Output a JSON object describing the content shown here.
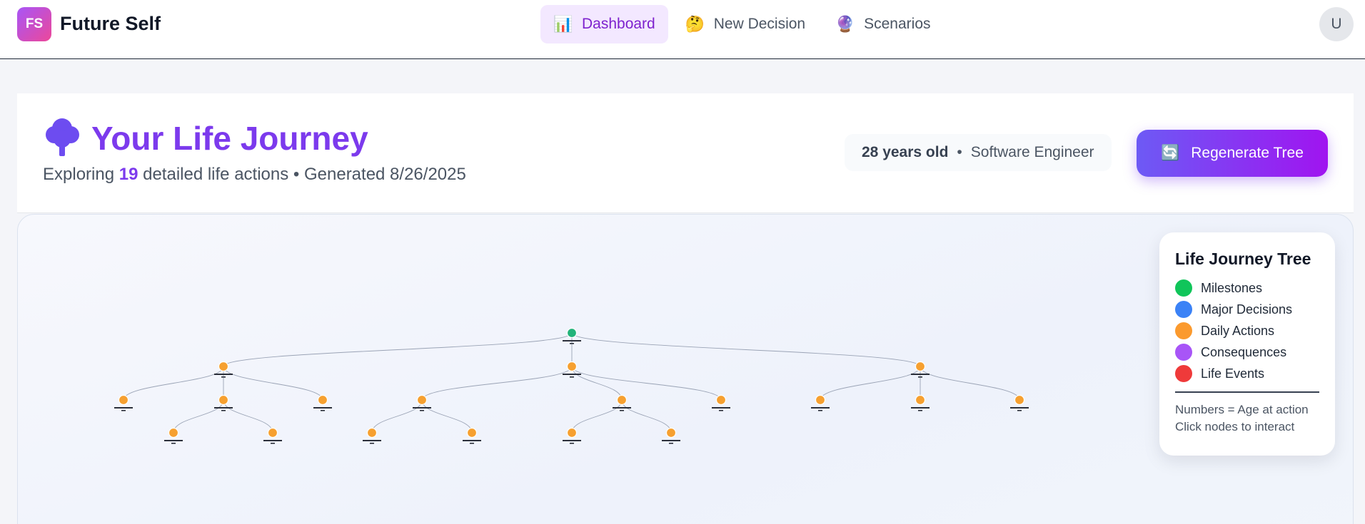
{
  "app": {
    "logo_text": "FS",
    "name": "Future Self"
  },
  "nav": {
    "items": [
      {
        "label": "Dashboard",
        "icon": "📊",
        "icon_name": "bar-chart-icon",
        "active": true
      },
      {
        "label": "New Decision",
        "icon": "🤔",
        "icon_name": "thinking-face-icon",
        "active": false
      },
      {
        "label": "Scenarios",
        "icon": "🔮",
        "icon_name": "crystal-ball-icon",
        "active": false
      }
    ],
    "avatar_initial": "U"
  },
  "header": {
    "title": "Your Life Journey",
    "subtitle_prefix": "Exploring",
    "action_count": "19",
    "subtitle_suffix": "detailed life actions • Generated 8/26/2025",
    "age_label": "28 years old",
    "separator": "•",
    "occupation": "Software Engineer",
    "regenerate_icon": "🔄",
    "regenerate_label": "Regenerate Tree"
  },
  "legend": {
    "title": "Life Journey Tree",
    "items": [
      {
        "label": "Milestones",
        "color": "#10c55a"
      },
      {
        "label": "Major Decisions",
        "color": "#3b82f6"
      },
      {
        "label": "Daily Actions",
        "color": "#fb9a2e"
      },
      {
        "label": "Consequences",
        "color": "#a855f7"
      },
      {
        "label": "Life Events",
        "color": "#ef3a3a"
      }
    ],
    "note_line1": "Numbers = Age at action",
    "note_line2": "Click nodes to interact"
  },
  "tree": {
    "colors": {
      "milestone": "#22b37a",
      "daily_action": "#f6a030",
      "link": "#9aa3b5"
    },
    "nodes": [
      {
        "id": "root",
        "type": "milestone",
        "parent": null
      },
      {
        "id": "a",
        "type": "daily_action",
        "parent": "root"
      },
      {
        "id": "b",
        "type": "daily_action",
        "parent": "root"
      },
      {
        "id": "c",
        "type": "daily_action",
        "parent": "root"
      },
      {
        "id": "a1",
        "type": "daily_action",
        "parent": "a"
      },
      {
        "id": "a2",
        "type": "daily_action",
        "parent": "a"
      },
      {
        "id": "a3",
        "type": "daily_action",
        "parent": "a"
      },
      {
        "id": "b1",
        "type": "daily_action",
        "parent": "b"
      },
      {
        "id": "b2",
        "type": "daily_action",
        "parent": "b"
      },
      {
        "id": "b3",
        "type": "daily_action",
        "parent": "b"
      },
      {
        "id": "c1",
        "type": "daily_action",
        "parent": "c"
      },
      {
        "id": "c2",
        "type": "daily_action",
        "parent": "c"
      },
      {
        "id": "c3",
        "type": "daily_action",
        "parent": "c"
      },
      {
        "id": "a2a",
        "type": "daily_action",
        "parent": "a2"
      },
      {
        "id": "a2b",
        "type": "daily_action",
        "parent": "a2"
      },
      {
        "id": "b1a",
        "type": "daily_action",
        "parent": "b1"
      },
      {
        "id": "b1b",
        "type": "daily_action",
        "parent": "b1"
      },
      {
        "id": "b2a",
        "type": "daily_action",
        "parent": "b2"
      },
      {
        "id": "b2b",
        "type": "daily_action",
        "parent": "b2"
      }
    ]
  }
}
